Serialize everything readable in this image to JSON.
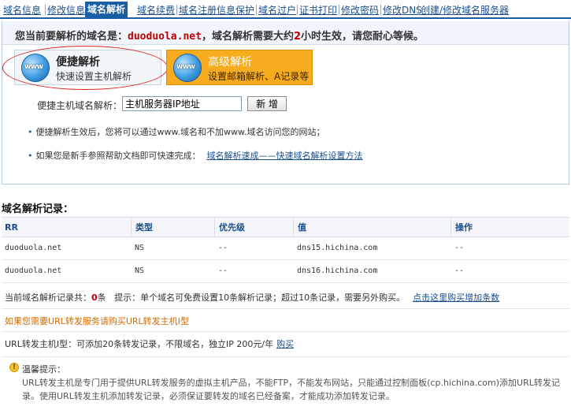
{
  "nav": {
    "tabs": [
      {
        "label": "域名信息"
      },
      {
        "label": "修改信息"
      },
      {
        "label": "域名解析"
      },
      {
        "label": "域名续费"
      },
      {
        "label": "域名注册信息保护"
      },
      {
        "label": "域名过户"
      },
      {
        "label": "证书打印"
      },
      {
        "label": "修改密码"
      },
      {
        "label": "修改DNS"
      },
      {
        "label": "创建/修改域名服务器"
      }
    ],
    "active": "域名解析"
  },
  "notice": {
    "prefix": "您当前要解析的域名是：",
    "domain": "duoduola.net",
    "middle": "，域名解析需要大约",
    "hours": "2",
    "suffix": "小时生效，请您耐心等候。"
  },
  "options": {
    "quick": {
      "icon_text": "www",
      "title": "便捷解析",
      "subtitle": "快速设置主机解析"
    },
    "advanced": {
      "icon_text": "www",
      "title": "高级解析",
      "subtitle": "设置邮箱解析、A记录等"
    }
  },
  "form": {
    "label": "便捷主机域名解析：",
    "input_value": "主机服务器IP地址",
    "button": "新 增"
  },
  "tips": {
    "tip1": "便捷解析生效后，您将可以通过www.域名和不加www.域名访问您的网站；",
    "tip2_text": "如果您是新手参照帮助文档即可快速完成：",
    "tip2_link": "域名解析速成——快速域名解析设置方法"
  },
  "records": {
    "title": "域名解析记录：",
    "columns": [
      "RR",
      "类型",
      "优先级",
      "值",
      "操作"
    ],
    "rows": [
      [
        "duoduola.net",
        "NS",
        "--",
        "dns15.hichina.com",
        "--"
      ],
      [
        "duoduola.net",
        "NS",
        "--",
        "dns16.hichina.com",
        "--"
      ]
    ]
  },
  "summary": {
    "prefix": "当前域名解析记录共：",
    "count": "0",
    "unit": "条",
    "hint": "提示：单个域名可免费设置10条解析记录；超过10条记录，需要另外购买。",
    "link": "点击这里购买增加条数"
  },
  "url_forward": {
    "orange_text": "如果您需要URL转发服务请购买URL转发主机I型",
    "text": "URL转发主机I型：可添加20条转发记录，不限域名，独立IP 200元/年",
    "link": "购买"
  },
  "warm_tip": {
    "icon": "warning-icon",
    "title": "温馨提示：",
    "body": "URL转发主机是专门用于提供URL转发服务的虚拟主机产品，不能FTP，不能发布网站，只能通过控制面板(cp.hichina.com)添加URL转发记录。使用URL转发主机添加转发记录，必须保证要转发的域名已经备案，才能成功添加转发记录。"
  },
  "colors": {
    "nav_active_bg": "#1a5fa5",
    "link": "#1a4e8a",
    "domain_red": "#c00000",
    "advanced_orange": "#f7ab1e",
    "warning_orange": "#d46b00",
    "ellipse_red": "#dd2222"
  }
}
